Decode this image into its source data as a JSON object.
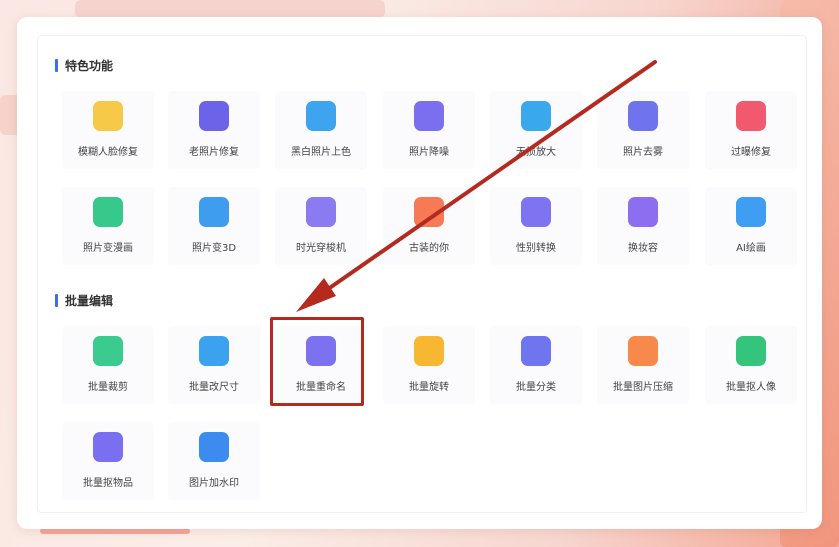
{
  "sections": {
    "featured": {
      "title": "特色功能"
    },
    "batch": {
      "title": "批量编辑"
    }
  },
  "featured_items": [
    {
      "label": "模糊人脸修复",
      "icon": "face-smile-icon",
      "color": "#f7c948"
    },
    {
      "label": "老照片修复",
      "icon": "photo-repair-icon",
      "color": "#6c63e8"
    },
    {
      "label": "黑白照片上色",
      "icon": "palette-icon",
      "color": "#3fa4f0"
    },
    {
      "label": "照片降噪",
      "icon": "denoise-icon",
      "color": "#7b6ff0"
    },
    {
      "label": "无损放大",
      "icon": "enlarge-icon",
      "color": "#3aa8ec"
    },
    {
      "label": "照片去雾",
      "icon": "defog-icon",
      "color": "#6f73ee"
    },
    {
      "label": "过曝修复",
      "icon": "overexposure-icon",
      "color": "#f15a6e"
    },
    {
      "label": "照片变漫画",
      "icon": "cartoon-icon",
      "color": "#36c98b"
    },
    {
      "label": "照片变3D",
      "icon": "cube-3d-icon",
      "color": "#3f9df0"
    },
    {
      "label": "时光穿梭机",
      "icon": "time-machine-icon",
      "color": "#8a7bf0"
    },
    {
      "label": "古装的你",
      "icon": "ancient-costume-icon",
      "color": "#f57a55"
    },
    {
      "label": "性别转换",
      "icon": "gender-swap-icon",
      "color": "#7e74f2"
    },
    {
      "label": "换妆容",
      "icon": "makeup-icon",
      "color": "#8c6ff0"
    },
    {
      "label": "AI绘画",
      "icon": "ai-painting-icon",
      "color": "#3e9ff2"
    }
  ],
  "batch_items": [
    {
      "label": "批量裁剪",
      "icon": "crop-icon",
      "color": "#3ccb8f"
    },
    {
      "label": "批量改尺寸",
      "icon": "resize-icon",
      "color": "#3aa2ee"
    },
    {
      "label": "批量重命名",
      "icon": "rename-icon",
      "color": "#7c72f0"
    },
    {
      "label": "批量旋转",
      "icon": "rotate-icon",
      "color": "#f7b731"
    },
    {
      "label": "批量分类",
      "icon": "classify-icon",
      "color": "#6f74ef"
    },
    {
      "label": "批量图片压缩",
      "icon": "compress-icon",
      "color": "#f7894b"
    },
    {
      "label": "批量抠人像",
      "icon": "portrait-cutout-icon",
      "color": "#35c47c"
    },
    {
      "label": "批量抠物品",
      "icon": "object-cutout-icon",
      "color": "#7a6ff0"
    },
    {
      "label": "图片加水印",
      "icon": "watermark-icon",
      "color": "#3c8cf0"
    }
  ],
  "highlight": {
    "target": "批量重命名",
    "color": "#b52a1f"
  }
}
